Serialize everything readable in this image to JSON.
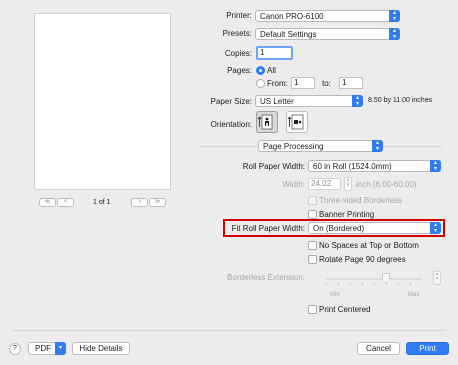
{
  "preview": {
    "page_indicator": "1 of 1",
    "nav_first": "≪",
    "nav_prev": "<",
    "nav_next": ">",
    "nav_last": "≫"
  },
  "printer": {
    "label": "Printer:",
    "value": "Canon PRO-6100"
  },
  "presets": {
    "label": "Presets:",
    "value": "Default Settings"
  },
  "copies": {
    "label": "Copies:",
    "value": "1"
  },
  "pages": {
    "label": "Pages:",
    "all_label": "All",
    "from_label": "From:",
    "from_value": "1",
    "to_label": "to:",
    "to_value": "1"
  },
  "paper_size": {
    "label": "Paper Size:",
    "value": "US Letter",
    "dimensions": "8.50 by 11.00 inches"
  },
  "orientation": {
    "label": "Orientation:"
  },
  "section": {
    "value": "Page Processing"
  },
  "roll_paper_width": {
    "label": "Roll Paper Width:",
    "value": "60 in Roll (1524.0mm)"
  },
  "width": {
    "label": "Width:",
    "value": "24.02",
    "unit": "inch (6.00-60.00)"
  },
  "three_sided_borderless": {
    "label": "Three-sided Borderless"
  },
  "banner_printing": {
    "label": "Banner Printing"
  },
  "fit_roll_paper_width": {
    "label": "Fit Roll Paper Width:",
    "value": "On (Bordered)"
  },
  "no_spaces": {
    "label": "No Spaces at Top or Bottom"
  },
  "rotate_page": {
    "label": "Rotate Page 90 degrees"
  },
  "borderless_extension": {
    "label": "Borderless Extension:",
    "min": "Min",
    "max": "Max"
  },
  "print_centered": {
    "label": "Print Centered"
  },
  "footer": {
    "help": "?",
    "pdf": "PDF",
    "hide_details": "Hide Details",
    "cancel": "Cancel",
    "print": "Print"
  },
  "colors": {
    "accent": "#2f7cf6",
    "highlight": "#d40000",
    "background": "#ececec"
  }
}
